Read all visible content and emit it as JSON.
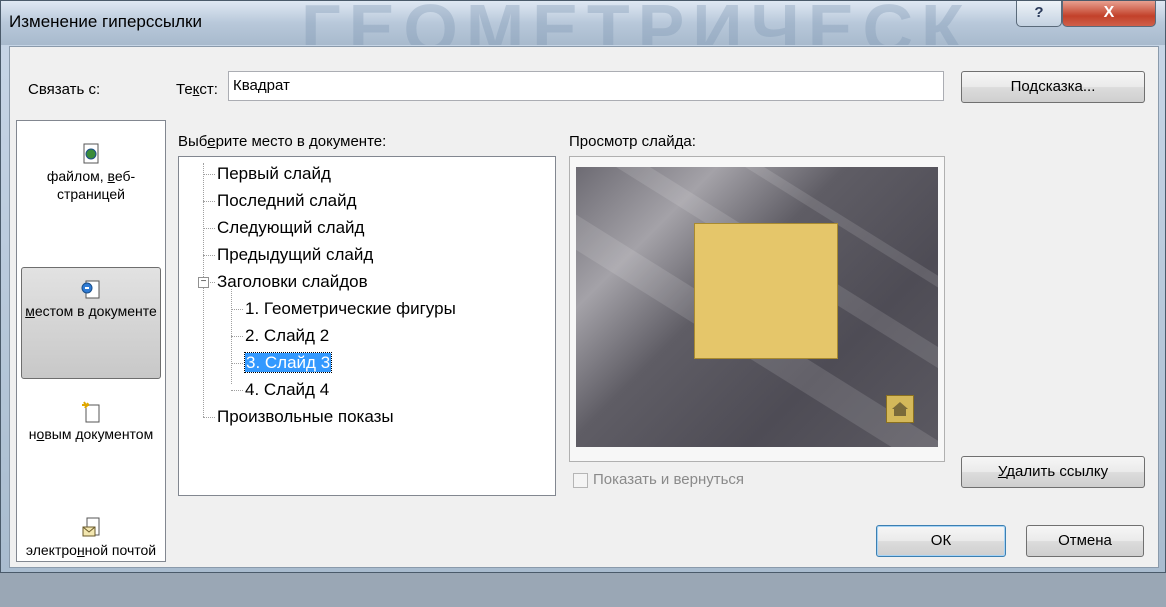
{
  "window": {
    "title": "Изменение гиперссылки",
    "title_watermark": "ГЕОМЕТРИЧЕСК",
    "help_label": "?",
    "close_label": "X"
  },
  "link_with": {
    "label": "Связать с:",
    "items": [
      {
        "pre": "файлом, ",
        "u": "в",
        "post": "еб-страницей",
        "icon": "web-page-icon",
        "active": false
      },
      {
        "pre": "",
        "u": "м",
        "post": "естом в документе",
        "icon": "place-in-document-icon",
        "active": true
      },
      {
        "pre": "н",
        "u": "о",
        "post": "вым документом",
        "icon": "new-document-icon",
        "active": false
      },
      {
        "pre": "электро",
        "u": "н",
        "post": "ной почтой",
        "icon": "email-icon",
        "active": false
      }
    ]
  },
  "text_field": {
    "label_pre": "Те",
    "label_u": "к",
    "label_post": "ст:",
    "value": "Квадрат"
  },
  "buttons": {
    "tooltip": {
      "pre": "По",
      "u": "д",
      "post": "сказка..."
    },
    "remove_link": {
      "pre": "",
      "u": "У",
      "post": "далить ссылку"
    },
    "ok": "ОК",
    "cancel": "Отмена"
  },
  "place": {
    "label_pre": "Выб",
    "label_u": "е",
    "label_post": "рите место в документе:",
    "tree": [
      {
        "text": "Первый слайд",
        "level": 0,
        "selected": false
      },
      {
        "text": "Последний слайд",
        "level": 0,
        "selected": false
      },
      {
        "text": "Следующий слайд",
        "level": 0,
        "selected": false
      },
      {
        "text": "Предыдущий слайд",
        "level": 0,
        "selected": false
      },
      {
        "text": "Заголовки слайдов",
        "level": 0,
        "selected": false,
        "expanded": true
      },
      {
        "text": "1. Геометрические фигуры",
        "level": 1,
        "selected": false
      },
      {
        "text": "2. Слайд 2",
        "level": 1,
        "selected": false
      },
      {
        "text": "3. Слайд 3",
        "level": 1,
        "selected": true
      },
      {
        "text": "4. Слайд 4",
        "level": 1,
        "selected": false
      },
      {
        "text": "Произвольные показы",
        "level": 0,
        "selected": false
      }
    ],
    "expander_symbol": "−"
  },
  "preview": {
    "label": "Просмотр слайда:",
    "show_and_return": "Показать и вернуться",
    "show_and_return_checked": false,
    "slide_background": "#5f5d65",
    "shape_color": "#e5c66a"
  }
}
